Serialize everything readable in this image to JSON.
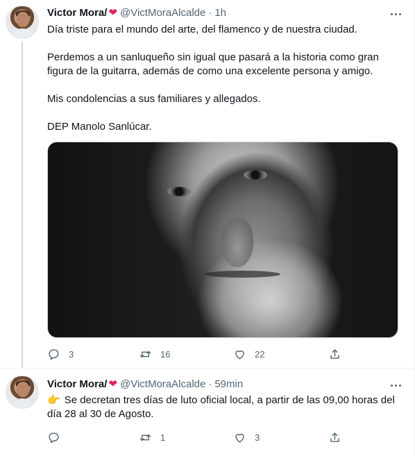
{
  "tweets": [
    {
      "author_name": "Victor Mora/",
      "heart": "❤",
      "handle": "@VictMoraAlcalde",
      "separator": "·",
      "time": "1h",
      "paragraphs": [
        "Día triste para el mundo del arte, del flamenco y de nuestra ciudad.",
        "Perdemos a un sanluqueño sin igual que pasará a la historia como gran figura de la guitarra, además de como una excelente persona y amigo.",
        "Mis condolencias a sus familiares y allegados.",
        "DEP Manolo Sanlúcar."
      ],
      "media": "black-and-white portrait photo",
      "actions": {
        "reply_count": "3",
        "retweet_count": "16",
        "like_count": "22"
      }
    },
    {
      "author_name": "Victor Mora/",
      "heart": "❤",
      "handle": "@VictMoraAlcalde",
      "separator": "·",
      "time": "59min",
      "emoji": "👉",
      "text": "Se decretan tres días de luto oficial local, a partir de las 09,00 horas del día 28 al 30 de Agosto.",
      "actions": {
        "reply_count": "",
        "retweet_count": "1",
        "like_count": "3"
      }
    }
  ],
  "icons": [
    "reply-icon",
    "retweet-icon",
    "like-icon",
    "share-icon",
    "more-icon"
  ],
  "colors": {
    "text": "#0f1419",
    "secondary": "#536471",
    "heart": "#e0245e",
    "divider": "#eff3f4"
  }
}
